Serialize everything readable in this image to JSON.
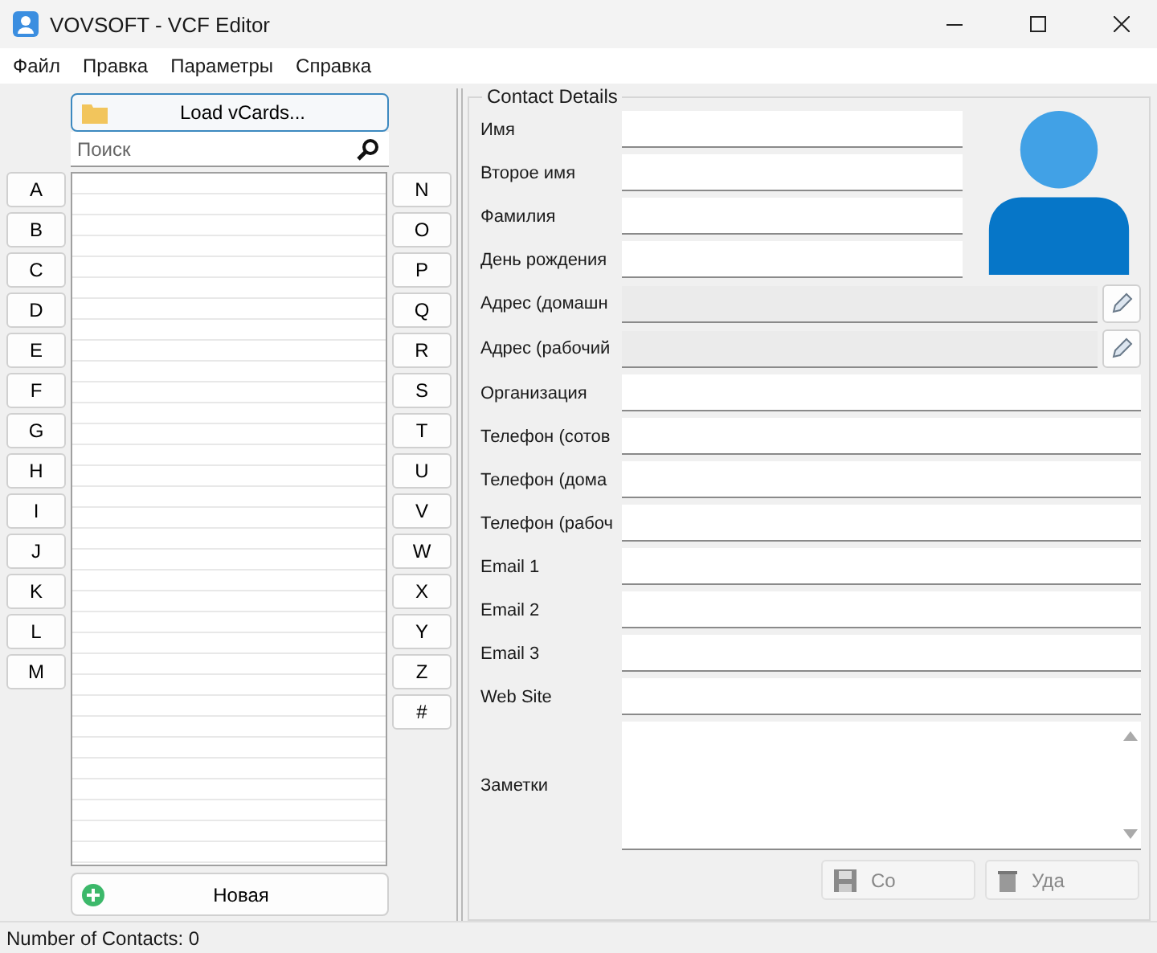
{
  "window": {
    "title": "VOVSOFT - VCF Editor"
  },
  "menu": [
    "Файл",
    "Правка",
    "Параметры",
    "Справка"
  ],
  "load_button": "Load vCards...",
  "search": {
    "placeholder": "Поиск"
  },
  "letters_left": [
    "A",
    "B",
    "C",
    "D",
    "E",
    "F",
    "G",
    "H",
    "I",
    "J",
    "K",
    "L",
    "M"
  ],
  "letters_right": [
    "N",
    "O",
    "P",
    "Q",
    "R",
    "S",
    "T",
    "U",
    "V",
    "W",
    "X",
    "Y",
    "Z",
    "#"
  ],
  "new_button": "Новая",
  "details": {
    "title": "Contact Details",
    "fields": [
      {
        "label": "Имя",
        "kind": "short"
      },
      {
        "label": "Второе имя",
        "kind": "short"
      },
      {
        "label": "Фамилия",
        "kind": "short"
      },
      {
        "label": "День рождения",
        "kind": "short"
      },
      {
        "label": "Адрес (домашн",
        "kind": "address"
      },
      {
        "label": "Адрес (рабочий",
        "kind": "address"
      },
      {
        "label": "Организация",
        "kind": "long"
      },
      {
        "label": "Телефон (сотов",
        "kind": "long"
      },
      {
        "label": "Телефон (дома",
        "kind": "long"
      },
      {
        "label": "Телефон (рабоч",
        "kind": "long"
      },
      {
        "label": "Email 1",
        "kind": "long"
      },
      {
        "label": "Email 2",
        "kind": "long"
      },
      {
        "label": "Email 3",
        "kind": "long"
      },
      {
        "label": "Web Site",
        "kind": "long"
      },
      {
        "label": "Заметки",
        "kind": "notes"
      }
    ],
    "buttons": [
      {
        "label": "Со",
        "kind": "save"
      },
      {
        "label": "Уда",
        "kind": "delete"
      }
    ]
  },
  "status_bar": "Number of Contacts: 0"
}
